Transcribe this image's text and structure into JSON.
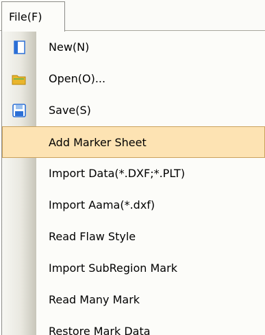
{
  "menu": {
    "title": "File(F)",
    "items": [
      {
        "label": "New(N)",
        "icon": "new-document-icon"
      },
      {
        "label": "Open(O)...",
        "icon": "open-folder-icon"
      },
      {
        "label": "Save(S)",
        "icon": "save-disk-icon"
      },
      {
        "label": "Add Marker Sheet",
        "highlighted": true
      },
      {
        "label": "Import Data(*.DXF;*.PLT)"
      },
      {
        "label": "Import Aama(*.dxf)"
      },
      {
        "label": "Read Flaw Style"
      },
      {
        "label": "Import SubRegion Mark"
      },
      {
        "label": "Read Many Mark"
      },
      {
        "label": "Restore Mark Data"
      }
    ]
  },
  "colors": {
    "highlight_fill": "#fde3b3",
    "highlight_border": "#c9a15d",
    "icon_blue": "#2b6fd6",
    "folder_yellow": "#e9b52c"
  }
}
